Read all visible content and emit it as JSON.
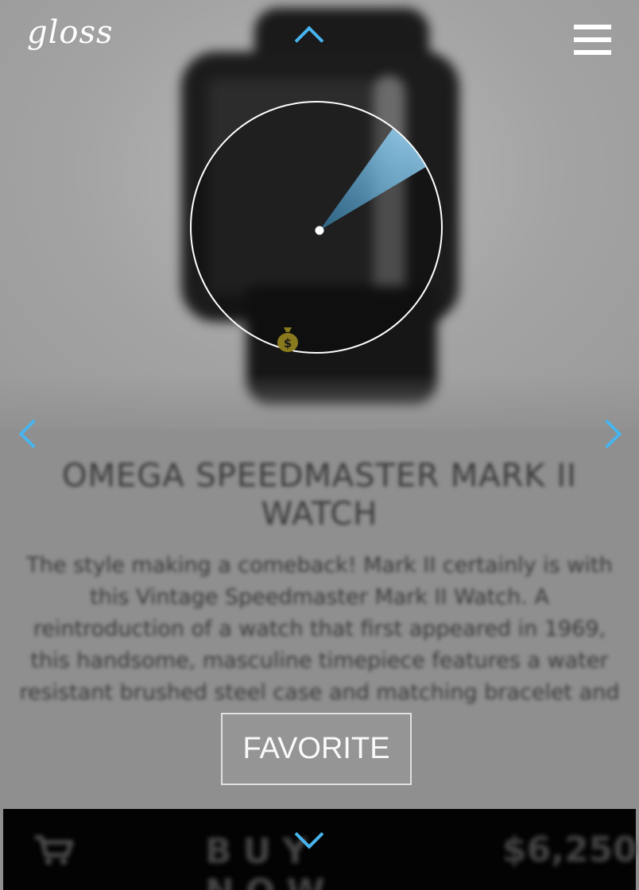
{
  "app": {
    "logo": "gloss"
  },
  "product": {
    "title": "OMEGA SPEEDMASTER MARK II WATCH",
    "description": "The style making a comeback! Mark II certainly is with this Vintage Speedmaster Mark II Watch. A reintroduction of a watch that first appeared in 1969, this handsome, masculine timepiece features a water resistant brushed steel case and matching bracelet and",
    "price": "$6,250"
  },
  "actions": {
    "favorite_label": "FAVORITE",
    "buy_label": "BUY NOW"
  },
  "icons": {
    "menu": "hamburger-menu-icon",
    "up": "chevron-up-icon",
    "down": "chevron-down-icon",
    "prev": "chevron-left-icon",
    "next": "chevron-right-icon",
    "money": "money-bag-icon",
    "cart": "cart-icon"
  },
  "colors": {
    "accent": "#48b4ee",
    "buy_bar": "#030303"
  }
}
